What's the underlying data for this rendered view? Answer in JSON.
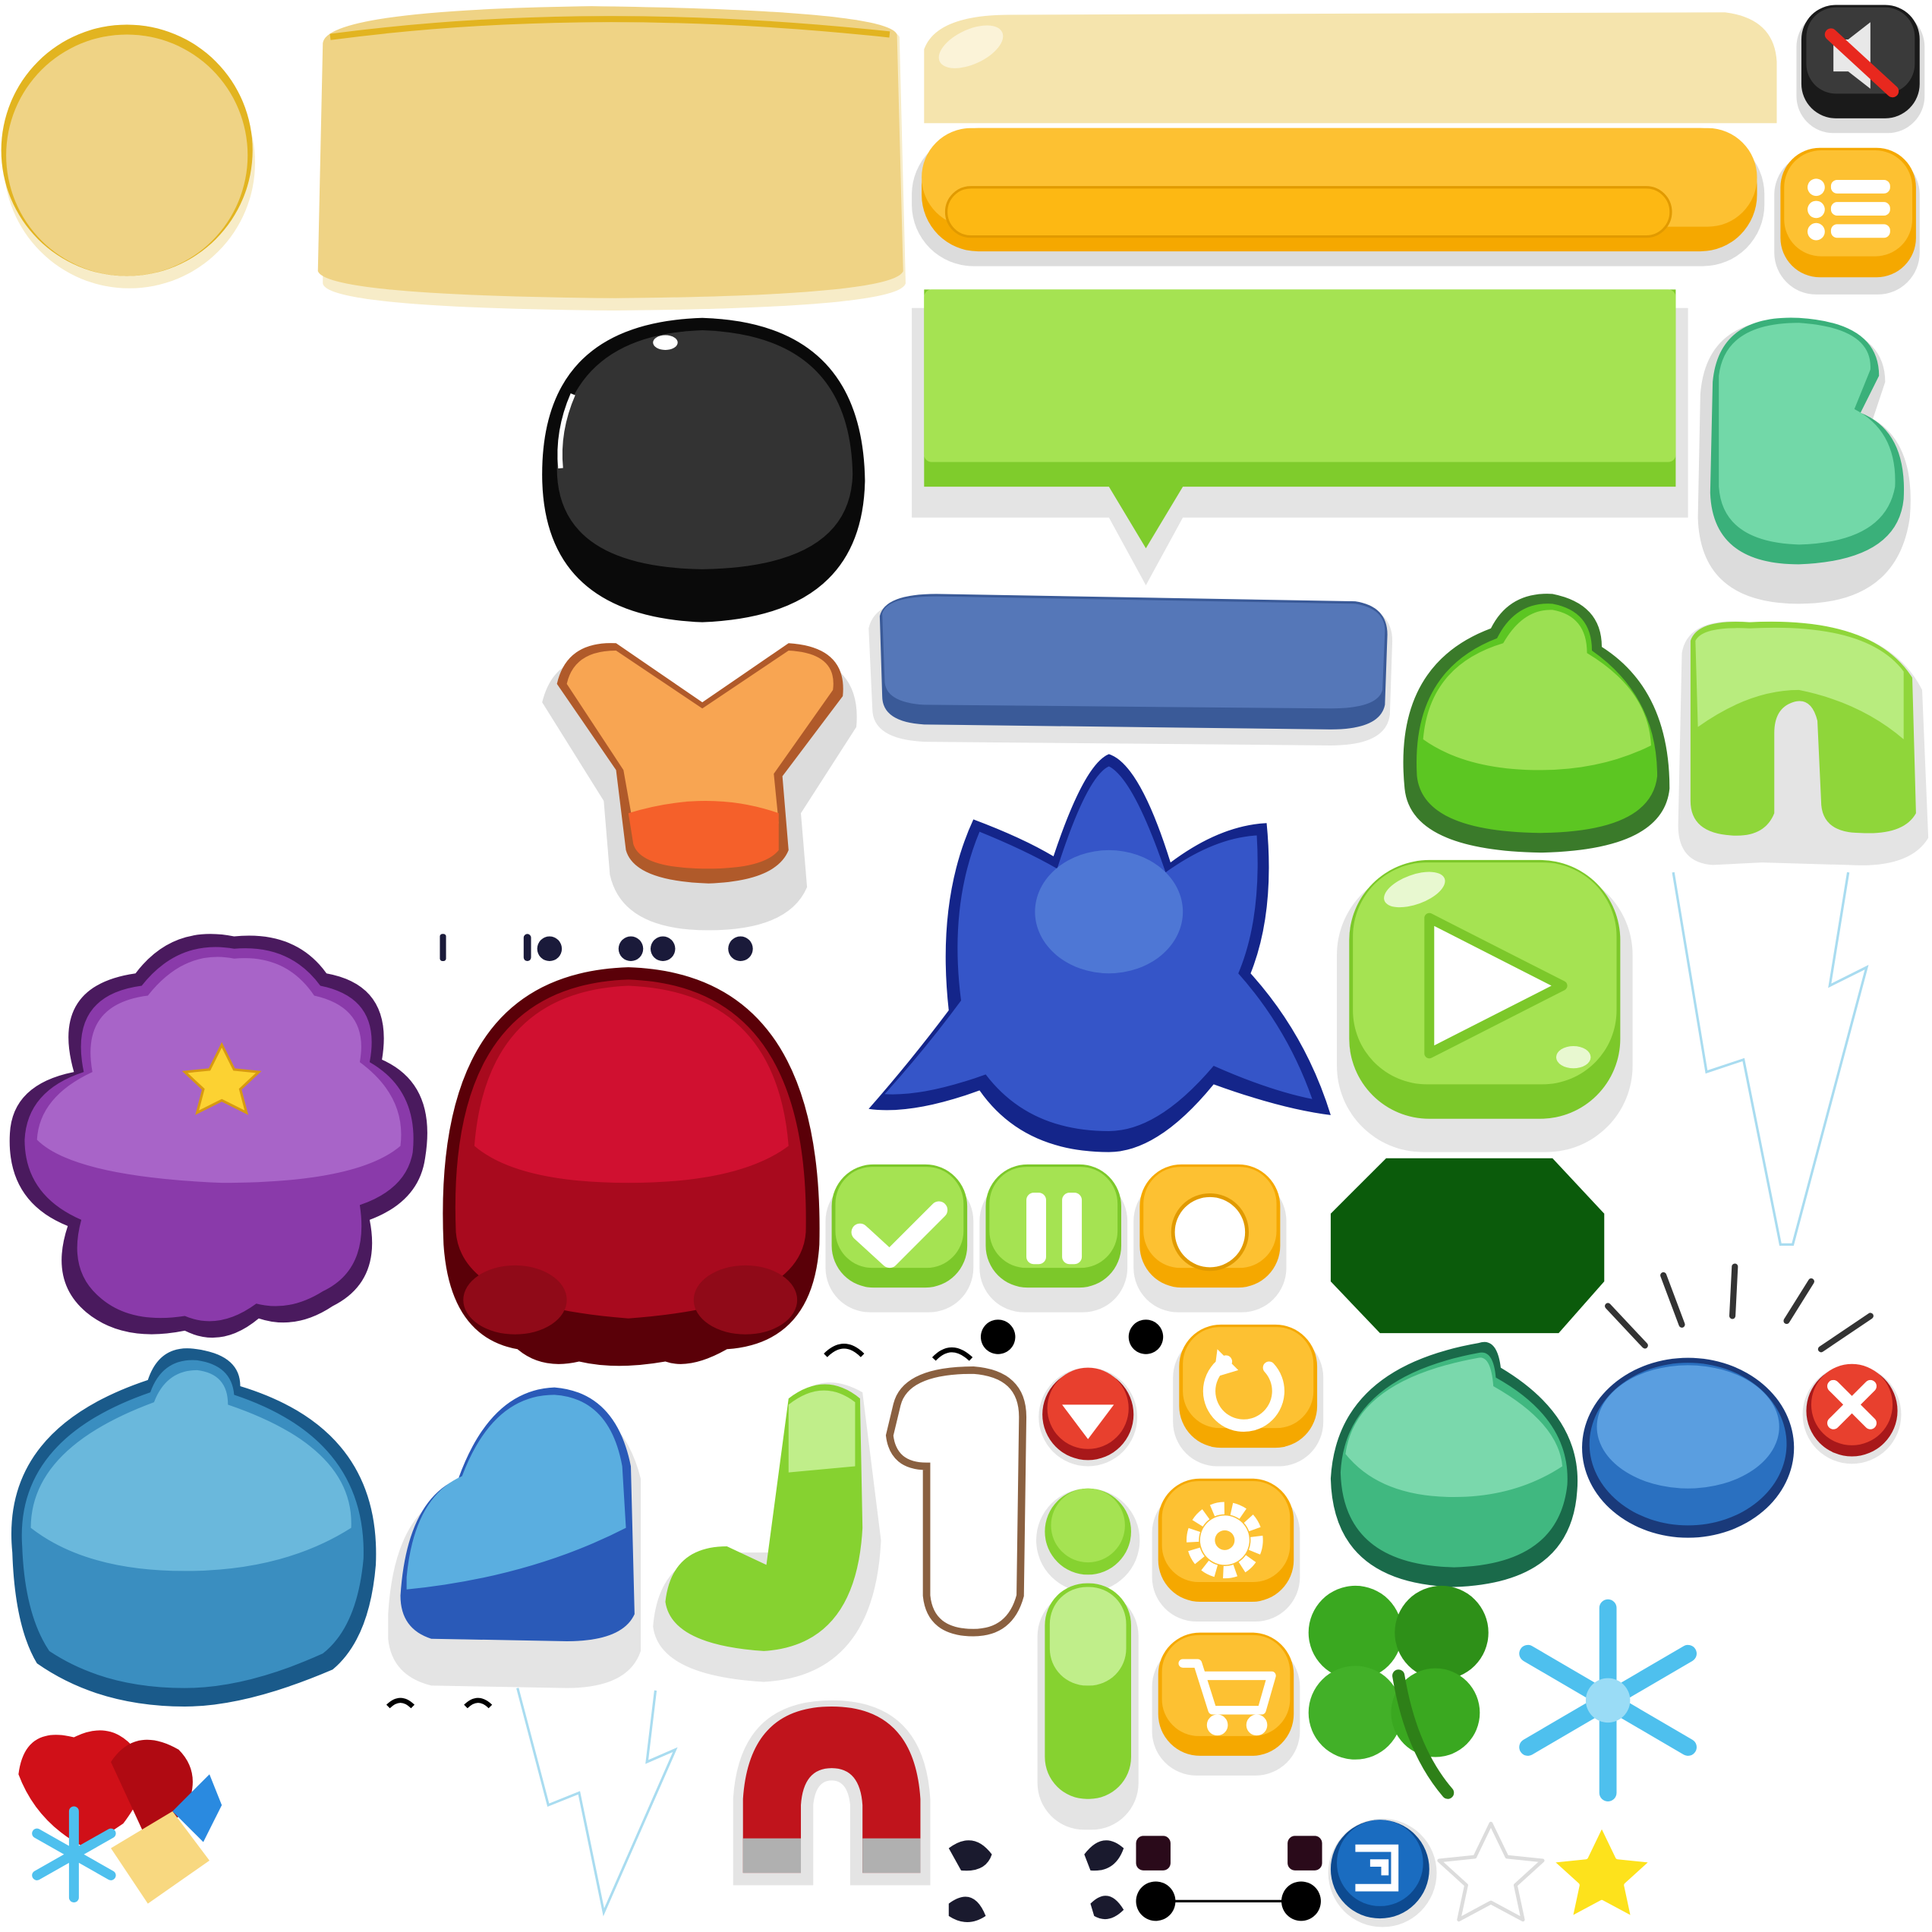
{
  "sheet": {
    "type": "sprite-atlas",
    "sprites": [
      {
        "name": "round-panel",
        "color": "#efd385"
      },
      {
        "name": "large-panel",
        "color": "#efd385"
      },
      {
        "name": "light-bar",
        "color": "#f5e4ad"
      },
      {
        "name": "progress-bar",
        "color": "#fdb813"
      },
      {
        "name": "mute-button",
        "color": "#2b2b2b"
      },
      {
        "name": "menu-button",
        "color": "#fdb813"
      },
      {
        "name": "black-blob",
        "color": "#1a1a1a"
      },
      {
        "name": "speech-bubble",
        "color": "#a5e352"
      },
      {
        "name": "letter-3",
        "color": "#5fcf9a"
      },
      {
        "name": "letter-y",
        "color": "#f79a3d"
      },
      {
        "name": "blue-bar",
        "color": "#5577b8"
      },
      {
        "name": "green-blob",
        "color": "#7fd43a"
      },
      {
        "name": "letter-n",
        "color": "#98df48"
      },
      {
        "name": "blue-star-blob",
        "color": "#3355c8"
      },
      {
        "name": "play-button",
        "color": "#98df48"
      },
      {
        "name": "purple-blob",
        "color": "#a45ec4"
      },
      {
        "name": "red-blob",
        "color": "#c8102e"
      },
      {
        "name": "check-button",
        "color": "#98df48"
      },
      {
        "name": "pause-button",
        "color": "#98df48"
      },
      {
        "name": "yellow-round-button",
        "color": "#fdb813"
      },
      {
        "name": "octagon",
        "color": "#0b5b0b"
      },
      {
        "name": "light-blue-blob",
        "color": "#5ab0d8"
      },
      {
        "name": "letter-l",
        "color": "#4a9ee0"
      },
      {
        "name": "letter-j",
        "color": "#98df48"
      },
      {
        "name": "number-1-outline",
        "color": "#8a6040"
      },
      {
        "name": "down-button",
        "color": "#e0302a"
      },
      {
        "name": "restart-button",
        "color": "#fdb813"
      },
      {
        "name": "teal-drop",
        "color": "#5fcf9a"
      },
      {
        "name": "blue-oval",
        "color": "#3e86d0"
      },
      {
        "name": "close-button",
        "color": "#e0302a"
      },
      {
        "name": "letter-i",
        "color": "#98df48"
      },
      {
        "name": "settings-button",
        "color": "#fdb813"
      },
      {
        "name": "shop-button",
        "color": "#fdb813"
      },
      {
        "name": "clover",
        "color": "#3aa820"
      },
      {
        "name": "snowflake",
        "color": "#4ec0ee"
      },
      {
        "name": "magnet",
        "color": "#c0141c"
      },
      {
        "name": "exit-button",
        "color": "#1559a8"
      },
      {
        "name": "star-empty",
        "color": "#ffffff"
      },
      {
        "name": "star-full",
        "color": "#fde21c"
      }
    ]
  }
}
